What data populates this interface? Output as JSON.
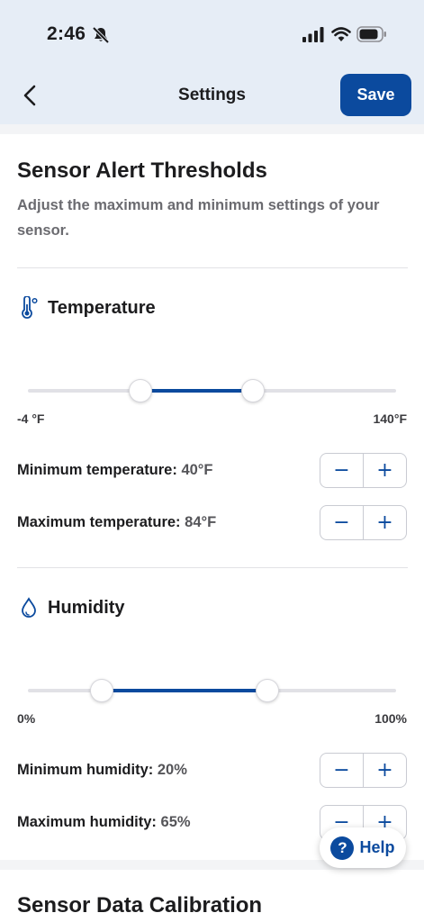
{
  "status_bar": {
    "time": "2:46"
  },
  "nav": {
    "title": "Settings",
    "save_label": "Save"
  },
  "thresholds": {
    "title": "Sensor Alert Thresholds",
    "description": "Adjust the maximum and minimum settings of your sensor."
  },
  "temperature": {
    "title": "Temperature",
    "range_min_label": "-4 °F",
    "range_max_label": "140°F",
    "range_min": -4,
    "range_max": 140,
    "selected_min": 40,
    "selected_max": 84,
    "min_label": "Minimum temperature:",
    "min_value": "40°F",
    "max_label": "Maximum temperature:",
    "max_value": "84°F"
  },
  "humidity": {
    "title": "Humidity",
    "range_min_label": "0%",
    "range_max_label": "100%",
    "range_min": 0,
    "range_max": 100,
    "selected_min": 20,
    "selected_max": 65,
    "min_label": "Minimum humidity:",
    "min_value": "20%",
    "max_label": "Maximum humidity:",
    "max_value": "65%"
  },
  "stepper": {
    "minus": "−",
    "plus": "+"
  },
  "help": {
    "icon": "?",
    "label": "Help"
  },
  "calibration": {
    "title": "Sensor Data Calibration"
  },
  "colors": {
    "accent": "#0b4a9e",
    "track": "#e1e1e6",
    "header_bg": "#e6edf6"
  }
}
